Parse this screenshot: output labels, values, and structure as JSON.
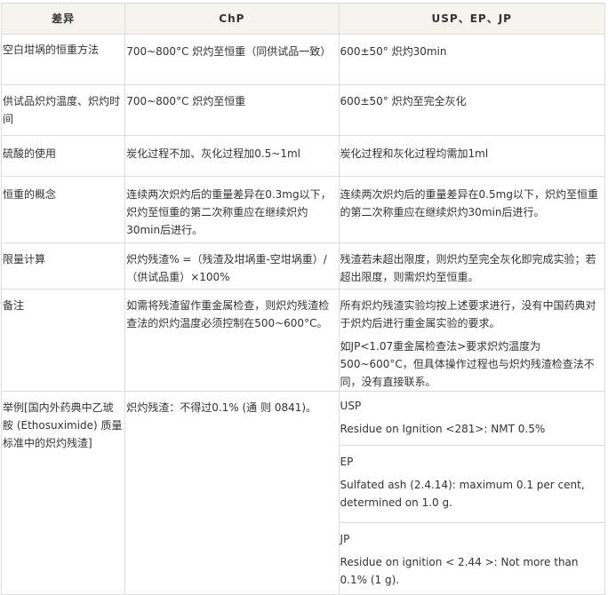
{
  "headers": [
    "差异",
    "ChP",
    "USP、EP、JP"
  ],
  "rows": [
    {
      "label": "空白坩埚的恒重方法",
      "chp": "700~800°C 炽灼至恒重（同供试品一致）",
      "usp": "600±50° 炽灼30min"
    },
    {
      "label": "供试品炽灼温度、炽灼时间",
      "chp": "700~800°C 炽灼至恒重",
      "usp": "600±50° 炽灼至完全灰化"
    },
    {
      "label": "硫酸的使用",
      "chp": "炭化过程不加、灰化过程加0.5~1ml",
      "usp": "炭化过程和灰化过程均需加1ml"
    },
    {
      "label": "恒重的概念",
      "chp": "连续两次炽灼后的重量差异在0.3mg以下，炽灼至恒重的第二次称重应在继续炽灼30min后进行。",
      "usp": "连续两次炽灼后的重量差异在0.5mg以下，炽灼至恒重的第二次称重应在继续炽灼30min后进行。"
    },
    {
      "label": "限量计算",
      "chp": "炽灼残渣% =（残渣及坩埚重-空坩埚重）/（供试品重）×100%",
      "usp": "残渣若未超出限度，则炽灼至完全灰化即完成实验；若超出限度，则需炽灼至恒重。"
    },
    {
      "label": "备注",
      "chp": "如需将残渣留作重金属检查，则炽灼残渣检查法的炽灼温度必须控制在500~600°C。",
      "usp_1": "所有炽灼残渣实验均按上述要求进行，没有中国药典对于炽灼后进行重金属实验的要求。",
      "usp_2": "如JP<1.07重金属检查法>要求炽灼温度为500~600°C，但具体操作过程也与炽灼残渣检查法不同，没有直接联系。"
    },
    {
      "label": "举例[国内外药典中乙琥胺 (Ethosuximide) 质量标准中的炽灼残渣]",
      "chp": "炽灼残渣：不得过0.1% (通 则 0841)。",
      "examples": [
        {
          "name": "USP",
          "text": "Residue on Ignition <281>: NMT 0.5%"
        },
        {
          "name": "EP",
          "text": "Sulfated ash (2.4.14): maximum 0.1 per cent, determined on 1.0 g."
        },
        {
          "name": "JP",
          "text": "Residue on ignition < 2.44 >: Not more than 0.1% (1 g)."
        }
      ]
    }
  ]
}
